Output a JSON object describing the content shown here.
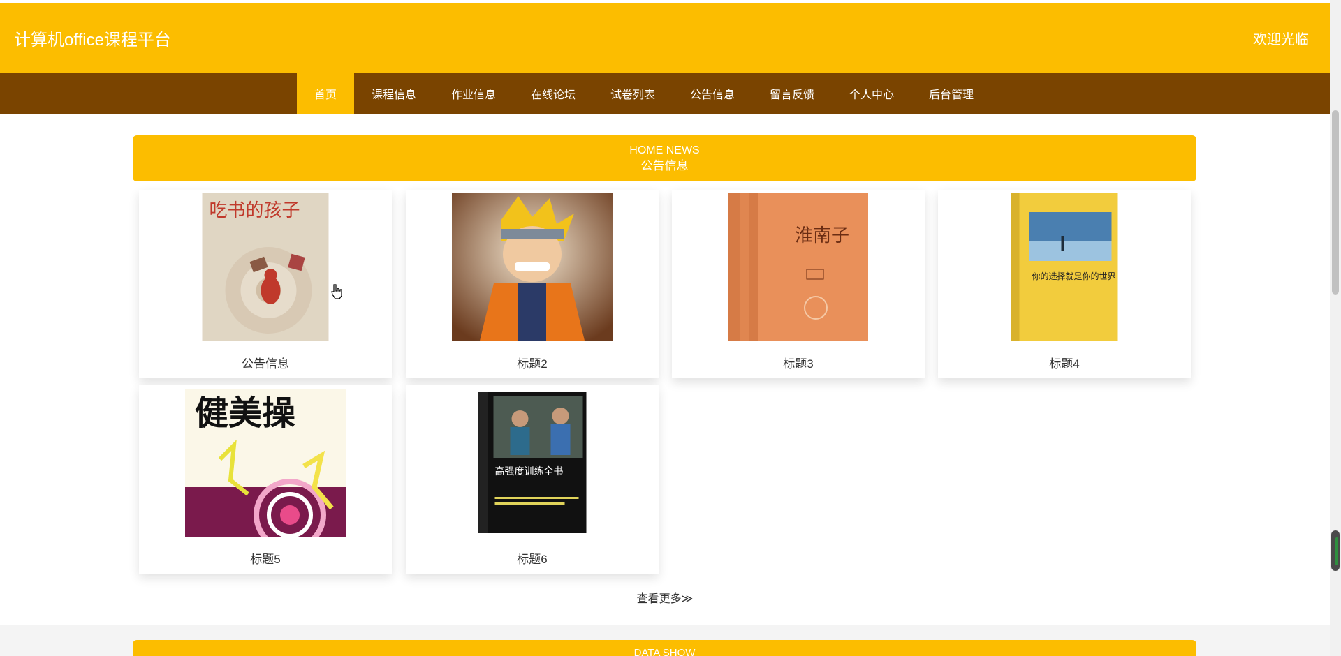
{
  "header": {
    "site_title": "计算机office课程平台",
    "welcome": "欢迎光临"
  },
  "nav": {
    "items": [
      {
        "label": "首页",
        "active": true
      },
      {
        "label": "课程信息"
      },
      {
        "label": "作业信息"
      },
      {
        "label": "在线论坛"
      },
      {
        "label": "试卷列表"
      },
      {
        "label": "公告信息"
      },
      {
        "label": "留言反馈"
      },
      {
        "label": "个人中心"
      },
      {
        "label": "后台管理"
      }
    ]
  },
  "news_section": {
    "title_en": "HOME NEWS",
    "title_cn": "公告信息",
    "cards": [
      {
        "title": "公告信息",
        "image": "book-cover-chi-shu-de-haizi",
        "cover_text": "吃书的孩子"
      },
      {
        "title": "标题2",
        "image": "anime-character-illustration"
      },
      {
        "title": "标题3",
        "image": "book-cover-huainanzi",
        "cover_text": "淮南子"
      },
      {
        "title": "标题4",
        "image": "book-cover-your-choice",
        "cover_text": "你的选择就是你的世界"
      },
      {
        "title": "标题5",
        "image": "book-cover-jianmeicao",
        "cover_text": "健美操"
      },
      {
        "title": "标题6",
        "image": "book-cover-high-intensity",
        "cover_text": "高强度训练全书"
      }
    ],
    "more_label": "查看更多≫"
  },
  "data_section": {
    "title_en": "DATA SHOW"
  },
  "colors": {
    "primary": "#fcbd00",
    "nav_bg": "#7a4400"
  }
}
